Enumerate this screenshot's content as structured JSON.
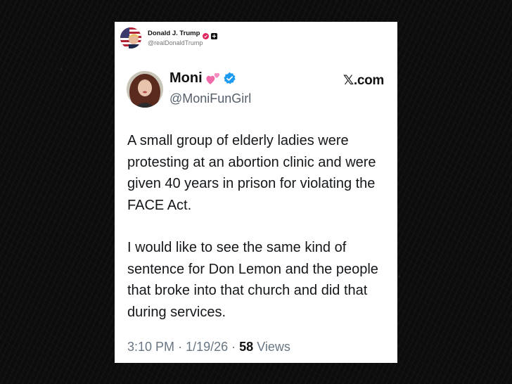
{
  "outer_post": {
    "author_name": "Donald J. Trump",
    "author_handle": "@realDonaldTrump",
    "avatar_icon": "flag-avatar-icon",
    "badges": [
      "pink-verified-badge-icon",
      "dark-affiliation-badge-icon"
    ]
  },
  "quoted_post": {
    "display_name": "Moni",
    "name_emoji_icon": "two-hearts-icon",
    "verified_icon": "blue-verified-badge-icon",
    "handle": "@MoniFunGirl",
    "source_label": "𝕏.com",
    "body": {
      "paragraph_1": "A small group of elderly ladies were protesting at an abortion clinic and were given 40 years in prison for violating the FACE Act.",
      "paragraph_2": "I would like to see the same kind of sentence for Don Lemon and the people that broke into that church and did that during services."
    },
    "meta": {
      "time": "3:10 PM",
      "separator": "·",
      "date": "1/19/26",
      "views_count": "58",
      "views_label": "Views"
    }
  },
  "colors": {
    "background": "#0b0b0b",
    "card": "#ffffff",
    "verified_blue": "#1d9bf0",
    "pink_badge": "#e0245e",
    "meta_gray": "#687684"
  }
}
